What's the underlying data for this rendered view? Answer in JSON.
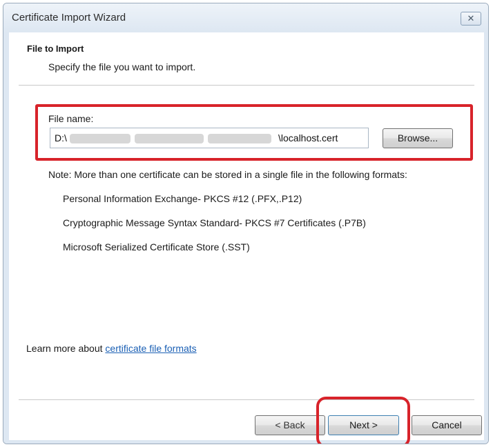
{
  "window": {
    "title": "Certificate Import Wizard",
    "close_glyph": "✕"
  },
  "header": {
    "title": "File to Import",
    "subtitle": "Specify the file you want to import."
  },
  "file": {
    "label": "File name:",
    "value_prefix": "D:\\",
    "value_suffix": "\\localhost.cert",
    "browse_label": "Browse..."
  },
  "note": {
    "text": "Note:  More than one certificate can be stored in a single file in the following formats:",
    "formats": [
      "Personal Information Exchange- PKCS #12 (.PFX,.P12)",
      "Cryptographic Message Syntax Standard- PKCS #7 Certificates (.P7B)",
      "Microsoft Serialized Certificate Store (.SST)"
    ]
  },
  "learn_more": {
    "prefix": "Learn more about ",
    "link_text": "certificate file formats"
  },
  "footer": {
    "back_label": "< Back",
    "next_label": "Next >",
    "cancel_label": "Cancel"
  },
  "colors": {
    "highlight": "#d8232a",
    "link": "#1a5fb4",
    "titlebar": "#dde7f2"
  }
}
